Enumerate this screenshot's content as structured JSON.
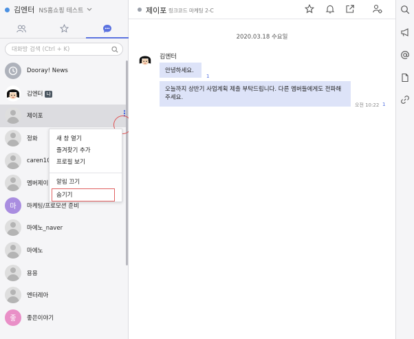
{
  "workspace": {
    "name": "김엔터",
    "subtitle": "NS홈쇼핑 테스트"
  },
  "sidebar": {
    "tabs": [
      {
        "name": "members",
        "icon": "people-icon"
      },
      {
        "name": "favorites",
        "icon": "star-icon"
      },
      {
        "name": "chats",
        "icon": "chat-bubble-icon",
        "active": true
      }
    ],
    "search": {
      "placeholder": "대화방 검색 (Ctrl + K)",
      "value": ""
    },
    "items": [
      {
        "label": "Dooray! News",
        "avatar": "clock-icon"
      },
      {
        "label": "김엔터",
        "badge": "나",
        "avatar": "cartoon-avatar"
      },
      {
        "label": "제이포",
        "avatar": "person",
        "selected": true
      },
      {
        "label": "정화",
        "avatar": "person"
      },
      {
        "label": "caren105",
        "avatar": "person"
      },
      {
        "label": "멤버제이",
        "avatar": "person"
      },
      {
        "label": "마케팅/프로모션 준비",
        "avatar": "letter",
        "letter": "마",
        "color": "#a98de0"
      },
      {
        "label": "마에노_naver",
        "avatar": "person"
      },
      {
        "label": "마에노",
        "avatar": "person"
      },
      {
        "label": "용용",
        "avatar": "person"
      },
      {
        "label": "엔터레아",
        "avatar": "person"
      },
      {
        "label": "좋은이야기",
        "avatar": "letter",
        "letter": "좋",
        "color": "#e98fc7"
      }
    ]
  },
  "context_menu": {
    "items": [
      "새 창 열기",
      "즐겨찾기 추가",
      "프로필 보기",
      "알림 끄기",
      "숨기기"
    ]
  },
  "chat": {
    "title": "제이포",
    "subtitle": "링크코드 마케팅 2-C",
    "date": "2020.03.18 수요일",
    "sender": "김엔터",
    "messages": [
      {
        "text": "안녕하세요.",
        "unread": "1"
      },
      {
        "text": "오늘까지 상반기 사업계획 제출 부탁드립니다. 다른 멤버들에게도 전파해주세요.",
        "time": "오전 10:22",
        "unread": "1"
      }
    ]
  },
  "colors": {
    "accent": "#5b72e0",
    "bubble": "#dde3f8",
    "highlight_ring": "#e05050"
  }
}
